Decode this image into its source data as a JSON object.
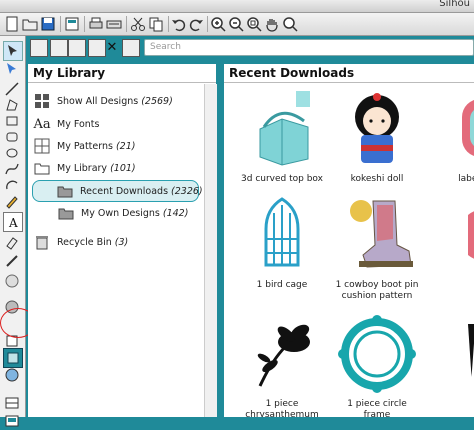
{
  "window": {
    "title": "Silhou"
  },
  "search": {
    "placeholder": "Search"
  },
  "library": {
    "heading": "My Library",
    "items": [
      {
        "label": "Show All Designs",
        "count": "(2569)"
      },
      {
        "label": "My Fonts",
        "count": ""
      },
      {
        "label": "My Patterns",
        "count": "(21)"
      },
      {
        "label": "My Library",
        "count": "(101)"
      },
      {
        "label": "Recent Downloads",
        "count": "(2326)"
      },
      {
        "label": "My Own Designs",
        "count": "(142)"
      },
      {
        "label": "Recycle Bin",
        "count": "(3)"
      }
    ]
  },
  "downloads": {
    "heading": "Recent Downloads",
    "items": [
      {
        "label": "3d curved top box",
        "label2": ""
      },
      {
        "label": "kokeshi doll",
        "label2": ""
      },
      {
        "label": "label f",
        "label2": ""
      },
      {
        "label": "1 bird cage",
        "label2": ""
      },
      {
        "label": "1 cowboy boot pin",
        "label2": "cushion pattern"
      },
      {
        "label": "",
        "label2": ""
      },
      {
        "label": "1 piece",
        "label2": "chrysanthemum"
      },
      {
        "label": "1 piece circle",
        "label2": "frame"
      },
      {
        "label": "",
        "label2": ""
      }
    ]
  },
  "colors": {
    "accent": "#1f8a99",
    "selection": "#2aa0b0",
    "annotation": "#dd2222"
  }
}
